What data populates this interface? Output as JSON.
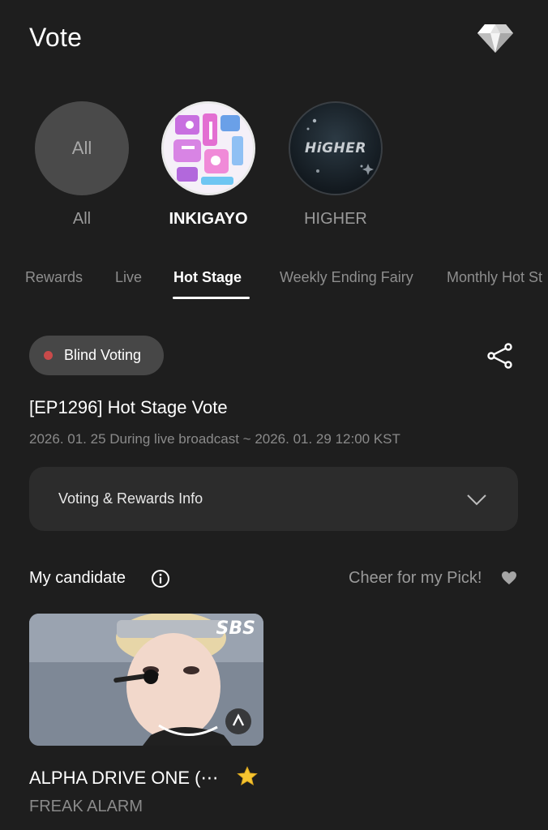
{
  "header": {
    "title": "Vote",
    "icon": "diamond-icon"
  },
  "programs": [
    {
      "label": "All",
      "circle_text": "All",
      "selected": false
    },
    {
      "label": "INKIGAYO",
      "selected": true
    },
    {
      "label": "HIGHER",
      "logo_text": "HiGHER",
      "selected": false
    }
  ],
  "tabs": [
    {
      "label": "Rewards"
    },
    {
      "label": "Live"
    },
    {
      "label": "Hot Stage",
      "active": true
    },
    {
      "label": "Weekly Ending Fairy"
    },
    {
      "label": "Monthly Hot St"
    }
  ],
  "vote": {
    "badge": "Blind Voting",
    "badge_dot_color": "#c94a4a",
    "title": "[EP1296] Hot Stage Vote",
    "period": "2026. 01. 25 During live broadcast ~ 2026. 01. 29 12:00 KST",
    "info_label": "Voting & Rewards Info"
  },
  "candidates_section": {
    "title": "My candidate",
    "cheer": "Cheer for my Pick!"
  },
  "candidate": {
    "name": "ALPHA DRIVE ONE (⋯",
    "song": "FREAK ALARM",
    "broadcaster": "SBS"
  },
  "colors": {
    "background": "#1e1e1e",
    "surface": "#2c2c2c",
    "badge": "#474747"
  }
}
